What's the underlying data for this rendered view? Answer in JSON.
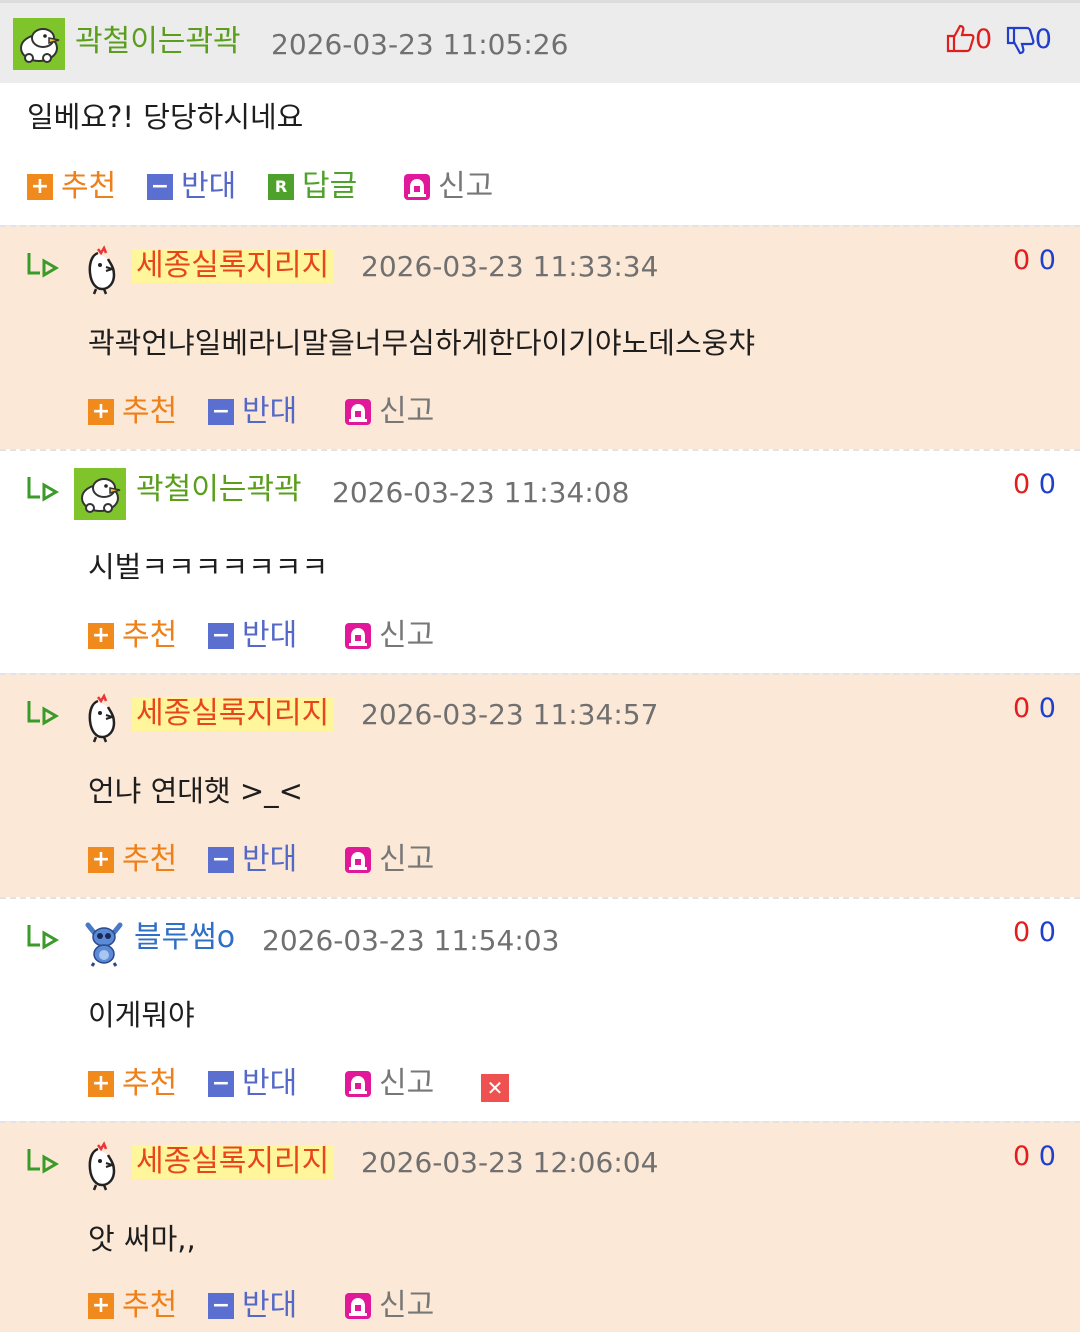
{
  "main_comment": {
    "nickname": "곽철이는곽곽",
    "timestamp": "2026-03-23 11:05:26",
    "up_count": "0",
    "down_count": "0",
    "text": "일베요?! 당당하시네요",
    "actions": {
      "recommend": "추천",
      "oppose": "반대",
      "reply": "답글",
      "report": "신고"
    }
  },
  "replies": [
    {
      "nickname": "세종실록지리지",
      "timestamp": "2026-03-23 11:33:34",
      "up": "0",
      "down": "0",
      "text": "곽곽언냐일베라니말을너무심하게한다이기야노데스웅챠",
      "recommend": "추천",
      "oppose": "반대",
      "report": "신고"
    },
    {
      "nickname": "곽철이는곽곽",
      "timestamp": "2026-03-23 11:34:08",
      "up": "0",
      "down": "0",
      "text": "시벌ㅋㅋㅋㅋㅋㅋㅋ",
      "recommend": "추천",
      "oppose": "반대",
      "report": "신고"
    },
    {
      "nickname": "세종실록지리지",
      "timestamp": "2026-03-23 11:34:57",
      "up": "0",
      "down": "0",
      "text": "언냐 연대햇 >_<",
      "recommend": "추천",
      "oppose": "반대",
      "report": "신고"
    },
    {
      "nickname": "블루썸o",
      "timestamp": "2026-03-23 11:54:03",
      "up": "0",
      "down": "0",
      "text": "이게뭐야",
      "recommend": "추천",
      "oppose": "반대",
      "report": "신고"
    },
    {
      "nickname": "세종실록지리지",
      "timestamp": "2026-03-23 12:06:04",
      "up": "0",
      "down": "0",
      "text": "앗 써마,,",
      "recommend": "추천",
      "oppose": "반대",
      "report": "신고"
    }
  ],
  "icons": {
    "thumb_up": "thumbs-up-icon",
    "thumb_down": "thumbs-down-icon",
    "reply_arrow": "reply-arrow-icon",
    "report": "siren-icon",
    "delete": "close-icon"
  },
  "colors": {
    "header_bg": "#ececec",
    "tint_bg": "#fce8d6",
    "green_nick": "#5a9e1c",
    "orange_nick": "#e8451c",
    "blue_nick": "#2f6fc6",
    "recommend": "#f08a1c",
    "oppose": "#5a6fcf",
    "up": "#e01e1e",
    "down": "#1f3fcc"
  }
}
